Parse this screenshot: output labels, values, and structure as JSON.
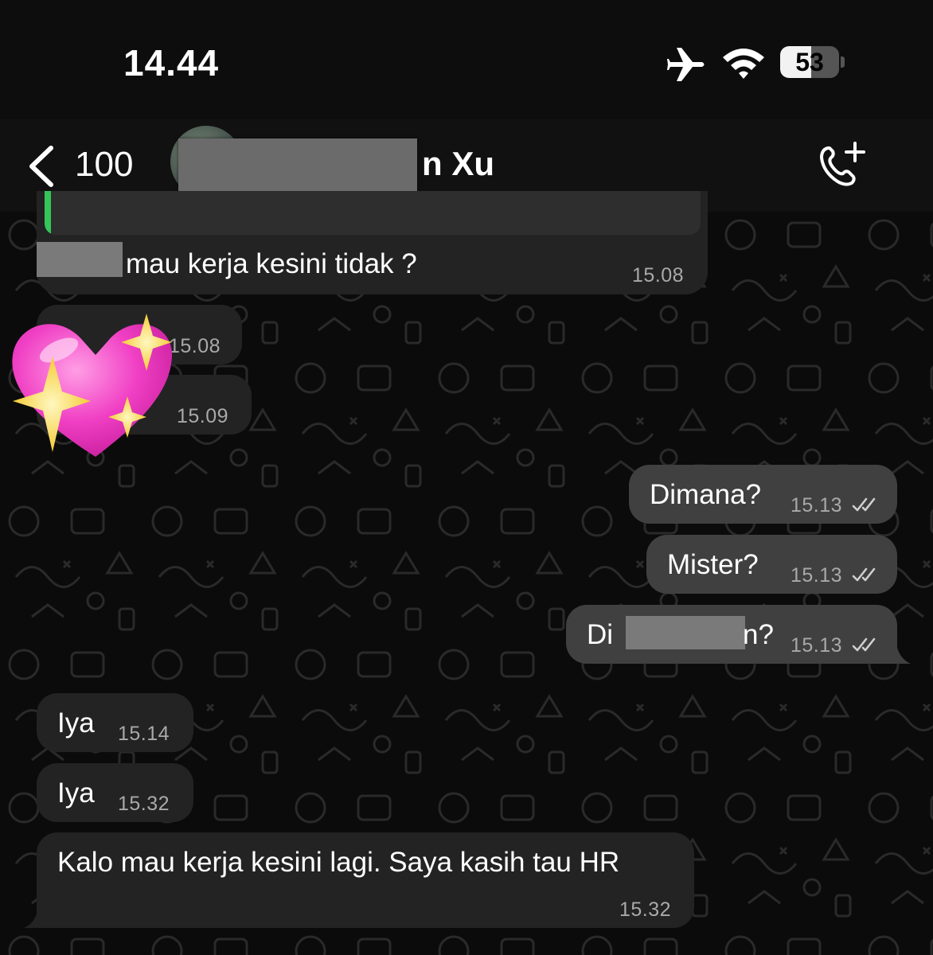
{
  "status_bar": {
    "time": "14.44",
    "battery_level": "53",
    "battery_fraction": 0.53
  },
  "header": {
    "back_count": "100",
    "contact_name_visible": "n Xu"
  },
  "messages": [
    {
      "id": "m1",
      "direction": "in",
      "text": "mau kerja kesini tidak ?",
      "time": "15.08"
    },
    {
      "id": "m2",
      "direction": "in",
      "sticker": "sparkling-heart",
      "time": "15.08"
    },
    {
      "id": "m3",
      "direction": "in",
      "time": "15.09"
    },
    {
      "id": "m4",
      "direction": "out",
      "text": "Dimana?",
      "time": "15.13",
      "status": "read"
    },
    {
      "id": "m5",
      "direction": "out",
      "text": "Mister?",
      "time": "15.13",
      "status": "read"
    },
    {
      "id": "m6",
      "direction": "out",
      "text_prefix": "Di",
      "text_suffix": "n?",
      "time": "15.13",
      "status": "read"
    },
    {
      "id": "m7",
      "direction": "in",
      "text": "Iya",
      "time": "15.14"
    },
    {
      "id": "m8",
      "direction": "in",
      "text": "Iya",
      "time": "15.32"
    },
    {
      "id": "m9",
      "direction": "in",
      "text": "Kalo mau kerja kesini lagi. Saya kasih tau HR",
      "time": "15.32"
    }
  ],
  "icons": {
    "airplane": "airplane-icon",
    "wifi": "wifi-icon",
    "back": "chevron-left-icon",
    "call_add": "phone-plus-icon",
    "read_ticks": "double-check-icon"
  },
  "colors": {
    "background": "#0b0b0b",
    "incoming_bubble": "#232323",
    "outgoing_bubble": "#404040",
    "timestamp": "#a9a9a9",
    "reply_accent": "#34c759"
  }
}
